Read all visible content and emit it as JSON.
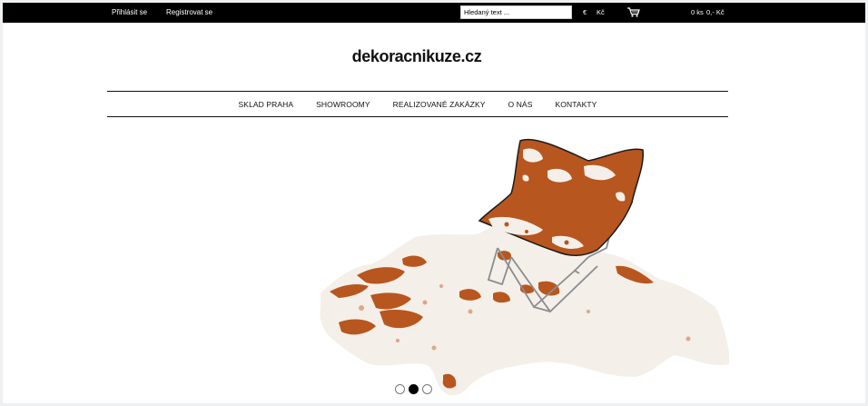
{
  "topbar": {
    "login": "Přihlásit se",
    "register": "Registrovat se",
    "search_placeholder": "Hledaný text ...",
    "currency_eur": "€",
    "currency_czk": "Kč",
    "cart_qty": "0 ks",
    "cart_price": "0,- Kč",
    "cart_icon": "cart-icon"
  },
  "logo": "dekoracnikuze.cz",
  "nav": [
    "SKLAD PRAHA",
    "SHOWROOMY",
    "REALIZOVANÉ ZAKÁZKY",
    "O NÁS",
    "KONTAKTY"
  ],
  "slider": {
    "slides": 3,
    "active": 2
  },
  "colors": {
    "topbar_bg": "#000000",
    "page_bg": "#ffffff",
    "hide_brown": "#b8561f",
    "hide_white": "#f4efe8"
  }
}
